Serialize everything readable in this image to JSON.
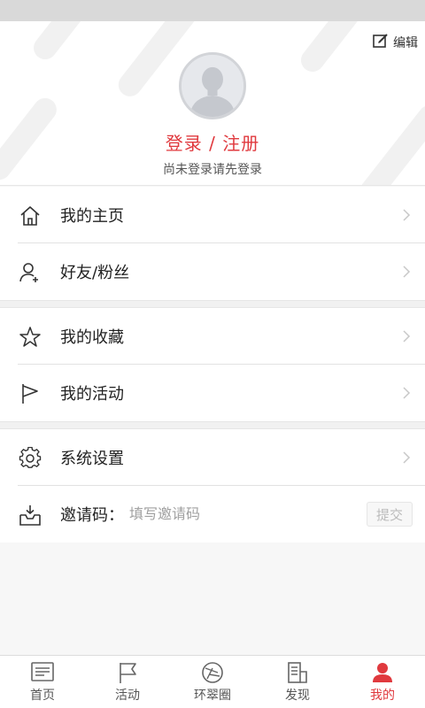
{
  "profile": {
    "edit_label": "编辑",
    "login_text": "登录 / 注册",
    "hint": "尚未登录请先登录"
  },
  "menu": [
    {
      "label": "我的主页",
      "icon": "home-icon"
    },
    {
      "label": "好友/粉丝",
      "icon": "add-friend-icon"
    },
    {
      "label": "我的收藏",
      "icon": "star-icon"
    },
    {
      "label": "我的活动",
      "icon": "flag-icon"
    },
    {
      "label": "系统设置",
      "icon": "gear-icon"
    }
  ],
  "invite": {
    "label": "邀请码：",
    "placeholder": "填写邀请码",
    "submit": "提交",
    "icon": "inbox-download-icon"
  },
  "tabs": [
    {
      "label": "首页",
      "icon": "news-icon",
      "active": false
    },
    {
      "label": "活动",
      "icon": "flag-icon",
      "active": false
    },
    {
      "label": "环翠圈",
      "icon": "compass-icon",
      "active": false
    },
    {
      "label": "发现",
      "icon": "discover-icon",
      "active": false
    },
    {
      "label": "我的",
      "icon": "person-icon",
      "active": true
    }
  ],
  "colors": {
    "accent": "#e0393e",
    "status_bar": "#d9d9d9",
    "background": "#f7f7f7"
  }
}
